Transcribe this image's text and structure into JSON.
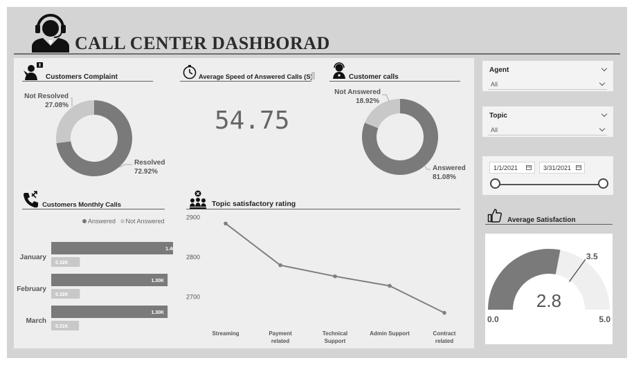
{
  "header": {
    "title": "CALL CENTER DASHBORAD"
  },
  "sections": {
    "complaint": {
      "title": "Customers Complaint"
    },
    "speed": {
      "title": "Average Speed of Answered Calls (S)",
      "value": "54.75"
    },
    "calls": {
      "title": "Customer calls"
    },
    "monthly": {
      "title": "Customers  Monthly Calls"
    },
    "topic_rating": {
      "title": "Topic satisfactory rating"
    },
    "satisfaction": {
      "title": "Average Satisfaction"
    }
  },
  "filters": {
    "agent": {
      "label": "Agent",
      "value": "All"
    },
    "topic": {
      "label": "Topic",
      "value": "All"
    },
    "date": {
      "start": "1/1/2021",
      "end": "3/31/2021",
      "slider": [
        0,
        1
      ]
    }
  },
  "colors": {
    "dark": "#7a7a7a",
    "light": "#c8c8c8",
    "gaugeBg": "#efefef",
    "line": "#7f7f7f"
  },
  "chart_data": [
    {
      "type": "pie",
      "title": "Customers Complaint",
      "slices": [
        {
          "name": "Resolved",
          "label": "72.92%",
          "value": 72.92
        },
        {
          "name": "Not Resolved",
          "label": "27.08%",
          "value": 27.08
        }
      ]
    },
    {
      "type": "pie",
      "title": "Customer calls",
      "slices": [
        {
          "name": "Answered",
          "label": "81.08%",
          "value": 81.08
        },
        {
          "name": "Not Answered",
          "label": "18.92%",
          "value": 18.92
        }
      ]
    },
    {
      "type": "bar",
      "title": "Customers  Monthly Calls",
      "categories": [
        "January",
        "February",
        "March"
      ],
      "series": [
        {
          "name": "Answered",
          "values": [
            1460,
            1300,
            1300
          ],
          "labels": [
            "1.46K",
            "1.30K",
            "1.30K"
          ]
        },
        {
          "name": "Not Answered",
          "values": [
            320,
            320,
            310
          ],
          "labels": [
            "0.32K",
            "0.32K",
            "0.31K"
          ]
        }
      ],
      "xlim": [
        0,
        1500
      ],
      "legend": "top-right"
    },
    {
      "type": "line",
      "title": "Topic satisfactory rating",
      "categories": [
        "Streaming",
        "Payment related",
        "Technical Support",
        "Admin Support",
        "Contract related"
      ],
      "values": [
        2885,
        2780,
        2752,
        2728,
        2660
      ],
      "yticks": [
        2900,
        2800,
        2700
      ],
      "ylim": [
        2640,
        2910
      ]
    },
    {
      "type": "gauge",
      "title": "Average Satisfaction",
      "value": 2.8,
      "value_label": "2.8",
      "min": 0,
      "min_label": "0.0",
      "max": 5,
      "max_label": "5.0",
      "target": 3.5,
      "target_label": "3.5"
    }
  ]
}
